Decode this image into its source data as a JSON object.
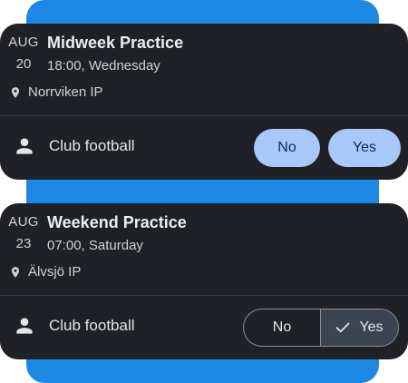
{
  "events": [
    {
      "month": "AUG",
      "day": "20",
      "title": "Midweek Practice",
      "time": "18:00, Wednesday",
      "location": "Norrviken IP",
      "team": "Club football",
      "rsvp": {
        "no_label": "No",
        "yes_label": "Yes",
        "selected": "none",
        "style": "filled-pills"
      }
    },
    {
      "month": "AUG",
      "day": "23",
      "title": "Weekend Practice",
      "time": "07:00, Saturday",
      "location": "Älvsjö IP",
      "team": "Club football",
      "rsvp": {
        "no_label": "No",
        "yes_label": "Yes",
        "selected": "yes",
        "style": "segmented"
      }
    }
  ],
  "icons": {
    "location": "location-pin-icon",
    "team": "person-icon",
    "selected": "check-icon"
  },
  "colors": {
    "accent_background": "#1e88e5",
    "card_background": "#1f2126",
    "pill_fill": "#a8c8fa",
    "segment_selected": "#3c4454"
  }
}
